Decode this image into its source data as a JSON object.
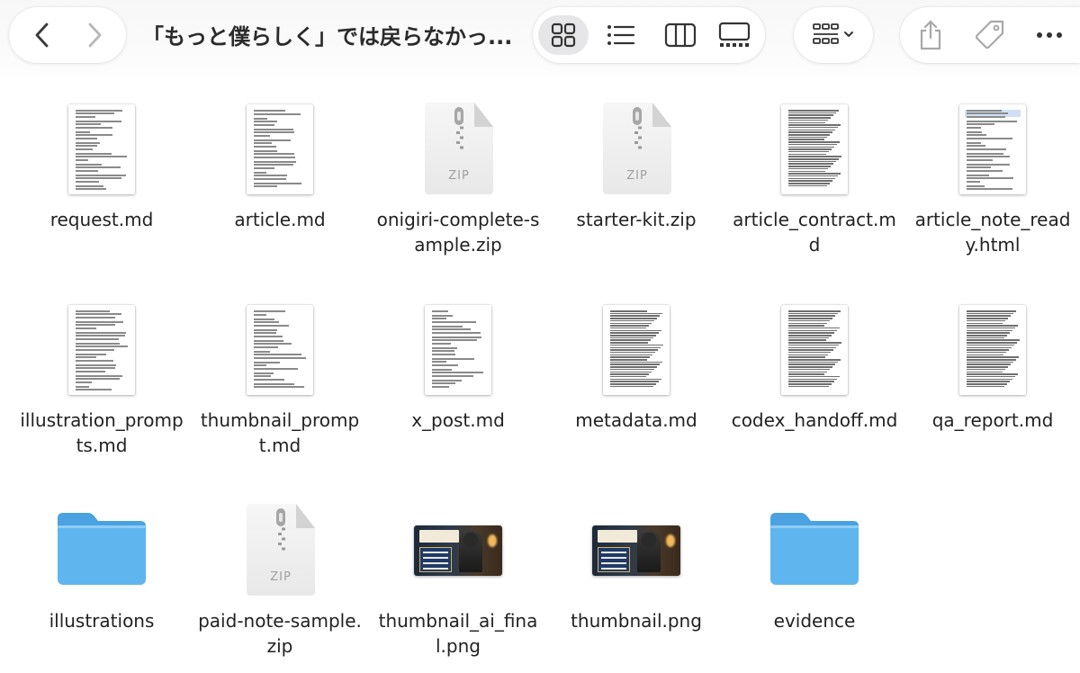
{
  "window": {
    "title": "「もっと僕らしく」では戻らなかっ..."
  },
  "toolbar": {
    "back_icon": "chevron-left-icon",
    "forward_icon": "chevron-right-icon",
    "views": [
      "icon-view",
      "list-view",
      "column-view",
      "gallery-view"
    ],
    "selected_view": "icon-view",
    "group_icon": "group-by-icon",
    "actions": [
      "share-icon",
      "tag-icon",
      "more-icon"
    ]
  },
  "files": [
    {
      "name": "request.md",
      "kind": "document"
    },
    {
      "name": "article.md",
      "kind": "document"
    },
    {
      "name": "onigiri-complete-sample.zip",
      "kind": "zip"
    },
    {
      "name": "starter-kit.zip",
      "kind": "zip"
    },
    {
      "name": "article_contract.md",
      "kind": "document"
    },
    {
      "name": "article_note_ready.html",
      "kind": "html"
    },
    {
      "name": "illustration_prompts.md",
      "kind": "document"
    },
    {
      "name": "thumbnail_prompt.md",
      "kind": "document"
    },
    {
      "name": "x_post.md",
      "kind": "document"
    },
    {
      "name": "metadata.md",
      "kind": "document"
    },
    {
      "name": "codex_handoff.md",
      "kind": "document"
    },
    {
      "name": "qa_report.md",
      "kind": "document"
    },
    {
      "name": "illustrations",
      "kind": "folder"
    },
    {
      "name": "paid-note-sample.zip",
      "kind": "zip"
    },
    {
      "name": "thumbnail_ai_final.png",
      "kind": "image"
    },
    {
      "name": "thumbnail.png",
      "kind": "image"
    },
    {
      "name": "evidence",
      "kind": "folder"
    }
  ],
  "zip_badge": "ZIP",
  "colors": {
    "folder": "#5fb6ee",
    "folder_tab": "#4aa3e0",
    "selected_view_bg": "#e6e6e8",
    "toolbar_icon": "#3a3a3a"
  }
}
